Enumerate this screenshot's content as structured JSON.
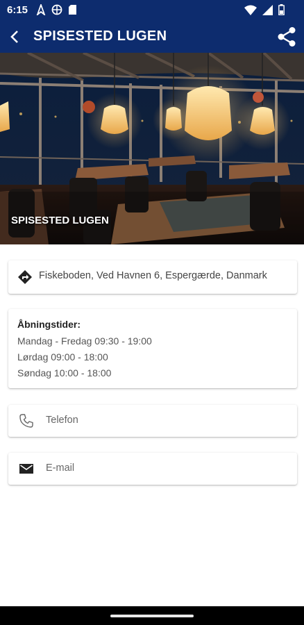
{
  "status_bar": {
    "time": "6:15",
    "icons": [
      "navigation-icon",
      "globe-icon",
      "sd-card-icon",
      "wifi-icon",
      "signal-icon",
      "battery-icon"
    ]
  },
  "app_bar": {
    "title": "SPISESTED LUGEN",
    "back_icon": "back-arrow-icon",
    "share_icon": "share-icon",
    "background": "#0d2c6e"
  },
  "hero": {
    "caption": "SPISESTED LUGEN"
  },
  "address": {
    "icon": "directions-icon",
    "text": "Fiskeboden, Ved Havnen 6, Espergærde, Danmark"
  },
  "hours": {
    "title": "Åbningstider:",
    "lines": [
      "Mandag - Fredag 09:30 - 19:00",
      "Lørdag 09:00 - 18:00",
      "Søndag 10:00 - 18:00"
    ]
  },
  "phone": {
    "icon": "phone-icon",
    "label": "Telefon"
  },
  "email": {
    "icon": "mail-icon",
    "label": "E-mail"
  }
}
